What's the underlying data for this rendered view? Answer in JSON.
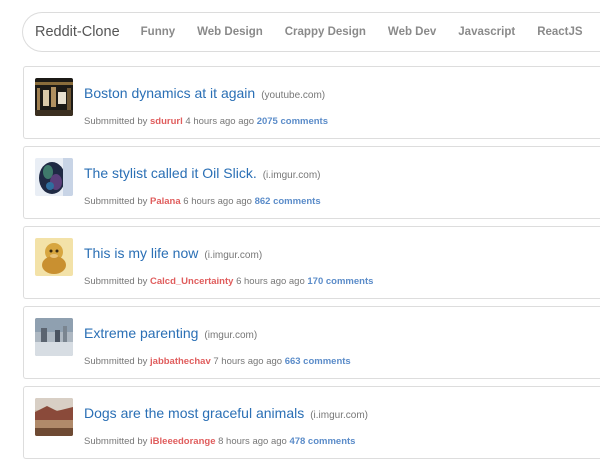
{
  "navbar": {
    "brand": "Reddit-Clone",
    "links": [
      "Funny",
      "Web Design",
      "Crappy Design",
      "Web Dev",
      "Javascript",
      "ReactJS"
    ]
  },
  "posts": [
    {
      "title": "Boston dynamics at it again",
      "domain": "(youtube.com)",
      "submitted_prefix": "Submmitted by",
      "author": "sdururl",
      "time": "4 hours ago ago",
      "comments": "2075 comments"
    },
    {
      "title": "The stylist called it Oil Slick.",
      "domain": "(i.imgur.com)",
      "submitted_prefix": "Submmitted by",
      "author": "Palana",
      "time": "6 hours ago ago",
      "comments": "862 comments"
    },
    {
      "title": "This is my life now",
      "domain": "(i.imgur.com)",
      "submitted_prefix": "Submmitted by",
      "author": "Calcd_Uncertainty",
      "time": "6 hours ago ago",
      "comments": "170 comments"
    },
    {
      "title": "Extreme parenting",
      "domain": "(imgur.com)",
      "submitted_prefix": "Submmitted by",
      "author": "jabbathechav",
      "time": "7 hours ago ago",
      "comments": "663 comments"
    },
    {
      "title": "Dogs are the most graceful animals",
      "domain": "(i.imgur.com)",
      "submitted_prefix": "Submmitted by",
      "author": "iBleeedorange",
      "time": "8 hours ago ago",
      "comments": "478 comments"
    }
  ],
  "colors": {
    "title_link": "#2a6fb5",
    "author": "#e05d5d",
    "comments_link": "#5b8cc9",
    "nav_link": "#8a8a8a"
  }
}
